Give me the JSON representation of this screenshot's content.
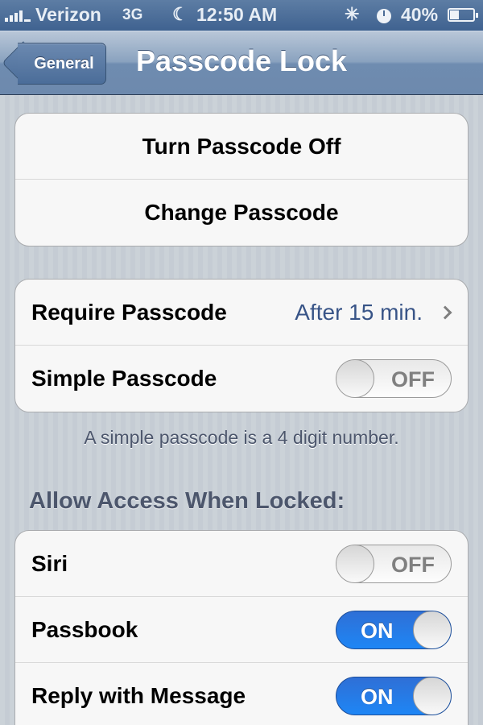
{
  "status_bar": {
    "carrier": "Verizon",
    "network": "3G",
    "time": "12:50 AM",
    "battery": "40%",
    "icons": [
      "signal-icon",
      "moon-icon",
      "activity-icon",
      "clock-icon",
      "battery-icon"
    ]
  },
  "nav": {
    "back_label": "General",
    "title": "Passcode Lock"
  },
  "group1": {
    "turn_off": "Turn Passcode Off",
    "change": "Change Passcode"
  },
  "group2": {
    "require_label": "Require Passcode",
    "require_value": "After 15 min.",
    "simple_label": "Simple Passcode",
    "simple_state": "OFF"
  },
  "note": "A simple passcode is a 4 digit number.",
  "section_header": "Allow Access When Locked:",
  "group3": {
    "siri_label": "Siri",
    "siri_state": "OFF",
    "passbook_label": "Passbook",
    "passbook_state": "ON",
    "reply_label": "Reply with Message",
    "reply_state": "ON"
  },
  "colors": {
    "accent": "#1e86f5",
    "value_text": "#385487",
    "background": "#c5ccd4"
  }
}
